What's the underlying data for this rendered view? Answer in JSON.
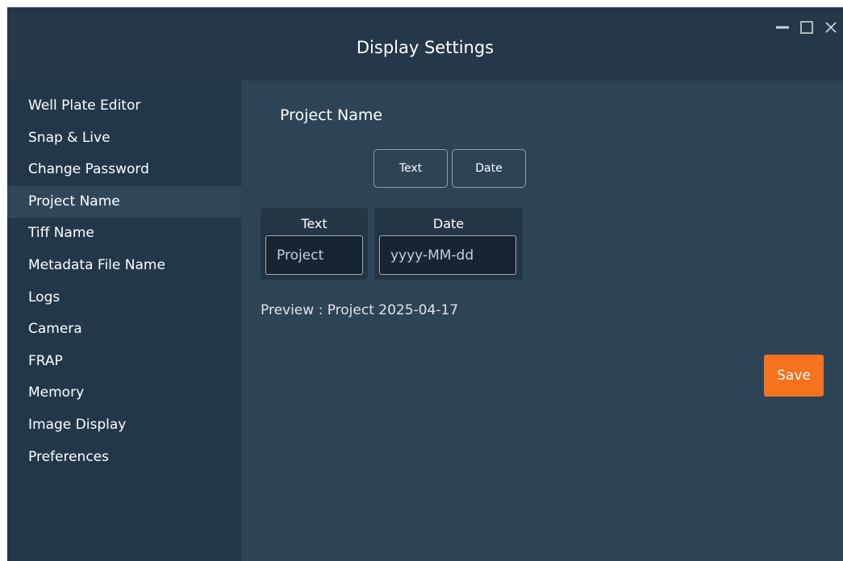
{
  "window": {
    "title": "Display Settings"
  },
  "sidebar": {
    "items": [
      {
        "label": "Well Plate Editor"
      },
      {
        "label": "Snap & Live"
      },
      {
        "label": "Change Password"
      },
      {
        "label": "Project Name",
        "active": true
      },
      {
        "label": "Tiff Name"
      },
      {
        "label": "Metadata File Name"
      },
      {
        "label": "Logs"
      },
      {
        "label": "Camera"
      },
      {
        "label": "FRAP"
      },
      {
        "label": "Memory"
      },
      {
        "label": "Image Display"
      },
      {
        "label": "Preferences"
      }
    ]
  },
  "main": {
    "section_title": "Project Name",
    "add_buttons": {
      "text_label": "Text",
      "date_label": "Date"
    },
    "fields": {
      "text": {
        "label": "Text",
        "value": "Project"
      },
      "date": {
        "label": "Date",
        "value": "yyyy-MM-dd"
      }
    },
    "preview": "Preview : Project 2025-04-17",
    "save_label": "Save"
  },
  "icons": {
    "minimize": "minimize-icon",
    "maximize": "maximize-icon",
    "close": "close-icon"
  },
  "colors": {
    "titlebar": "#24384a",
    "sidebar": "#23374a",
    "sidebar_active": "#2f4759",
    "content": "#2d4356",
    "accent": "#f5721e"
  }
}
